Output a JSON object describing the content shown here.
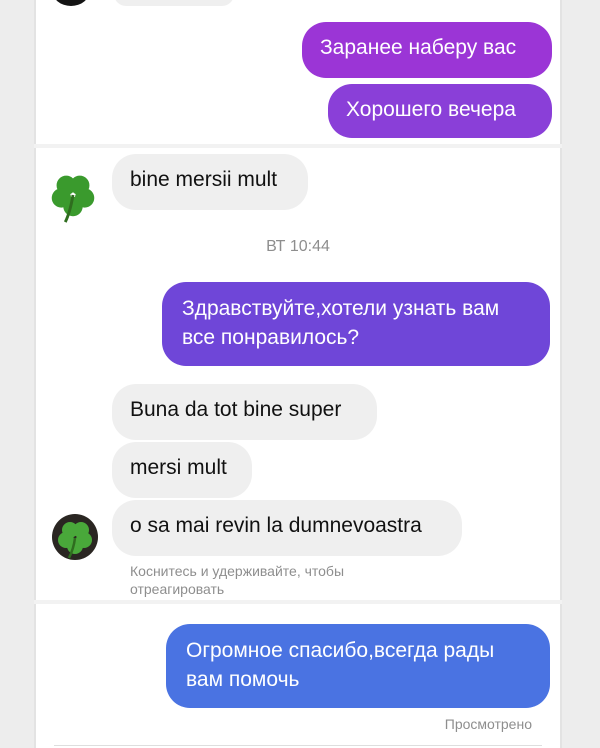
{
  "colors": {
    "outgoing_top": "#9b35d6",
    "outgoing_mid": "#6f46d8",
    "outgoing_bottom": "#4a73e2",
    "incoming": "#efefef",
    "meta_text": "#8e8e8e"
  },
  "avatars": {
    "icon": "shamrock-clover-icon"
  },
  "messages": {
    "m1": "Заранее наберу вас",
    "m2": "Хорошего вечера",
    "m3": "bine mersii mult",
    "m4": "Здравствуйте,хотели узнать вам все понравилось?",
    "m5": "Buna da tot bine super",
    "m6": "mersi mult",
    "m7": "o sa mai revin la dumnevoastra",
    "m8": "Огромное спасибо,всегда рады вам помочь"
  },
  "meta": {
    "timestamp": "ВТ 10:44",
    "hint": "Коснитесь и удерживайте, чтобы отреагировать",
    "seen": "Просмотрено"
  }
}
